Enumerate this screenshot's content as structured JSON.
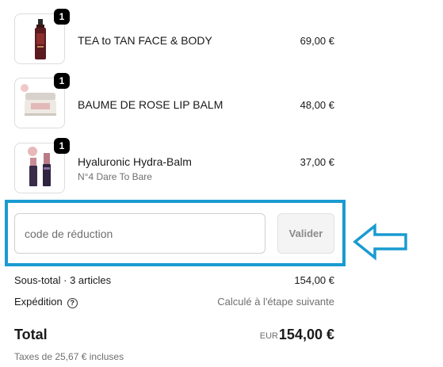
{
  "cart": {
    "items": [
      {
        "quantity": "1",
        "name": "TEA to TAN FACE & BODY",
        "variant": "",
        "price": "69,00 €",
        "image_icon": "bottle-icon"
      },
      {
        "quantity": "1",
        "name": "BAUME DE ROSE LIP BALM",
        "variant": "",
        "price": "48,00 €",
        "image_icon": "jar-icon"
      },
      {
        "quantity": "1",
        "name": "Hyaluronic Hydra-Balm",
        "variant": "N°4 Dare To Bare",
        "price": "37,00 €",
        "image_icon": "lipstick-icon"
      }
    ]
  },
  "discount": {
    "placeholder": "code de réduction",
    "value": "",
    "apply_label": "Valider"
  },
  "summary": {
    "subtotal_label": "Sous-total · 3 articles",
    "subtotal_value": "154,00 €",
    "shipping_label": "Expédition",
    "shipping_value": "Calculé à l'étape suivante",
    "total_label": "Total",
    "currency": "EUR",
    "total_value": "154,00 €",
    "taxes": "Taxes de 25,67 € incluses"
  },
  "colors": {
    "highlight": "#1a9bd1",
    "badge": "#000000"
  }
}
